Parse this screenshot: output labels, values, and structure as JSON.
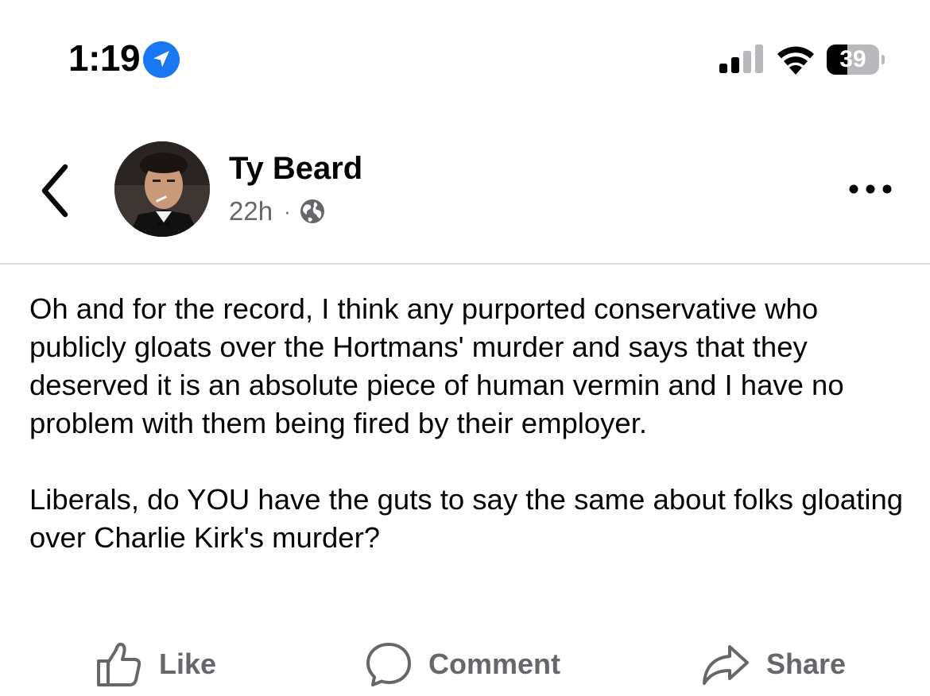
{
  "status_bar": {
    "time": "1:19",
    "battery_level": "39",
    "battery_percent": 39,
    "location_icon": "location-arrow-icon",
    "signal_icon": "cellular-signal-icon",
    "signal_bars_active": 2,
    "wifi_icon": "wifi-icon",
    "accent_color": "#1877f2"
  },
  "post": {
    "author_name": "Ty Beard",
    "timestamp": "22h",
    "separator": "·",
    "audience_icon": "globe-icon",
    "paragraphs": [
      "Oh and for the record, I think any purported conservative who publicly gloats over the Hortmans' murder and says that they deserved it is an absolute piece of human vermin and I have no problem with them being fired by their employer.",
      "Liberals, do YOU have the guts to say the same about folks gloating over Charlie Kirk's murder?"
    ]
  },
  "actions": {
    "like_label": "Like",
    "comment_label": "Comment",
    "share_label": "Share",
    "like_icon": "thumbs-up-icon",
    "comment_icon": "speech-bubble-icon",
    "share_icon": "share-arrow-icon",
    "label_color": "#65676b"
  }
}
